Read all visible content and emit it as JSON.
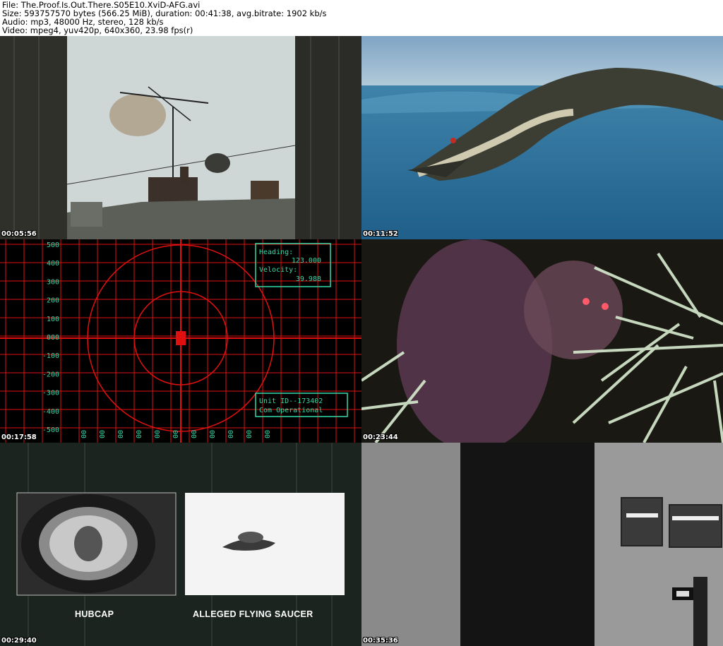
{
  "info": {
    "file": "File: The.Proof.Is.Out.There.S05E10.XviD-AFG.avi",
    "size": "Size: 593757570 bytes (566.25 MiB), duration: 00:41:38, avg.bitrate: 1902 kb/s",
    "audio": "Audio: mp3, 48000 Hz, stereo, 128 kb/s",
    "video": "Video: mpeg4, yuv420p, 640x360, 23.98 fps(r)"
  },
  "frames": [
    {
      "timestamp": "00:05:56"
    },
    {
      "timestamp": "00:11:52"
    },
    {
      "timestamp": "00:17:58"
    },
    {
      "timestamp": "00:23:44"
    },
    {
      "timestamp": "00:29:40"
    },
    {
      "timestamp": "00:35:36"
    }
  ],
  "radar": {
    "heading_label": "Heading:",
    "heading_value": "123.000",
    "velocity_label": "Velocity:",
    "velocity_value": "39.988",
    "unit_id": "Unit ID--173402",
    "status": "Com Operational",
    "y_ticks": [
      "500",
      "400",
      "300",
      "200",
      "100",
      "000",
      "-100",
      "-200",
      "-300",
      "-400",
      "-500"
    ],
    "x_ticks": [
      "00",
      "00",
      "00",
      "00",
      "00",
      "00",
      "00",
      "00",
      "00",
      "00",
      "00"
    ]
  },
  "compare": {
    "left_caption": "HUBCAP",
    "right_caption": "ALLEGED FLYING SAUCER"
  },
  "colors": {
    "radar_grid": "#e01010",
    "hud_text": "#36d8a8"
  }
}
